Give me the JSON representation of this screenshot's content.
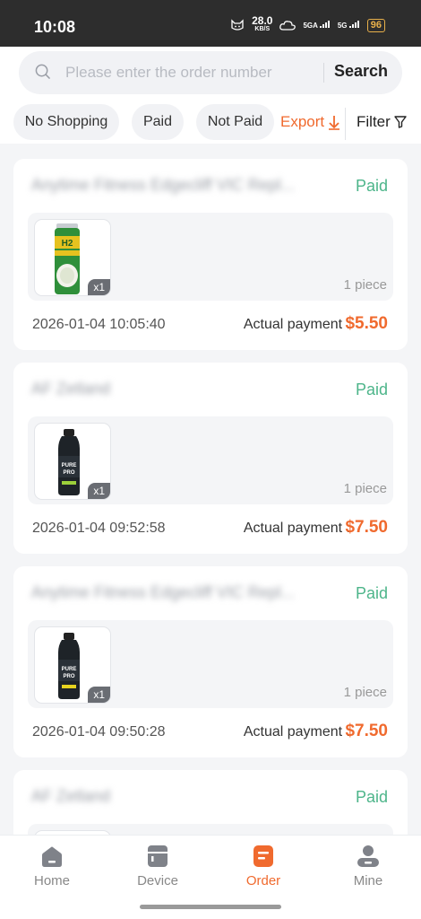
{
  "status_bar": {
    "time": "10:08",
    "net_speed_value": "28.0",
    "net_speed_unit": "KB/S",
    "signal_1": "5GA",
    "signal_2": "5G",
    "battery": "96"
  },
  "search": {
    "placeholder": "Please enter the order number",
    "button_label": "Search"
  },
  "filters": {
    "chips": [
      "No Shopping",
      "Paid",
      "Not Paid"
    ],
    "export_label": "Export",
    "filter_label": "Filter"
  },
  "orders": [
    {
      "store": "Anytime Fitness Edgecliff VIC Repl...",
      "status": "Paid",
      "qty": "x1",
      "pieces": "1 piece",
      "datetime": "2026-01-04 10:05:40",
      "pay_label": "Actual payment :",
      "amount": "$5.50",
      "product_icon": "coconut-water-can-icon"
    },
    {
      "store": "AF Zetland",
      "status": "Paid",
      "qty": "x1",
      "pieces": "1 piece",
      "datetime": "2026-01-04 09:52:58",
      "pay_label": "Actual payment :",
      "amount": "$7.50",
      "product_icon": "protein-bottle-icon"
    },
    {
      "store": "Anytime Fitness Edgecliff VIC Repl...",
      "status": "Paid",
      "qty": "x1",
      "pieces": "1 piece",
      "datetime": "2026-01-04 09:50:28",
      "pay_label": "Actual payment :",
      "amount": "$7.50",
      "product_icon": "protein-bottle-icon"
    },
    {
      "store": "AF Zetland",
      "status": "Paid"
    }
  ],
  "tabbar": {
    "home": "Home",
    "device": "Device",
    "order": "Order",
    "mine": "Mine",
    "active": "Order"
  },
  "colors": {
    "accent": "#f06a2e",
    "paid": "#4db58a"
  }
}
